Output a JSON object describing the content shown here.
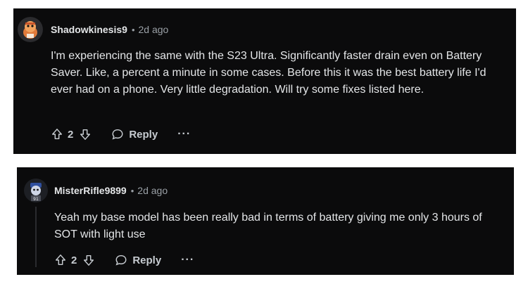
{
  "comments": [
    {
      "username": "Shadowkinesis9",
      "separator": "•",
      "time": "2d ago",
      "body": "I'm experiencing the same with the S23 Ultra. Significantly faster drain even on Battery Saver. Like, a percent a minute in some cases. Before this it was the best battery life I'd ever had on a phone. Very little degradation. Will try some fixes listed here.",
      "score": "2",
      "reply_label": "Reply",
      "more_label": "···"
    },
    {
      "username": "MisterRifle9899",
      "separator": "•",
      "time": "2d ago",
      "body": "Yeah my base model has been really bad in terms of battery giving me only 3 hours of SOT with light use",
      "score": "2",
      "reply_label": "Reply",
      "more_label": "···"
    }
  ],
  "icons": {
    "upvote": "upvote-arrow-icon",
    "downvote": "downvote-arrow-icon",
    "reply": "speech-bubble-icon",
    "more": "ellipsis-icon"
  },
  "colors": {
    "card_background": "#0b0b0c",
    "text_primary": "#e4e6e8",
    "text_secondary": "#9aa0a6"
  }
}
